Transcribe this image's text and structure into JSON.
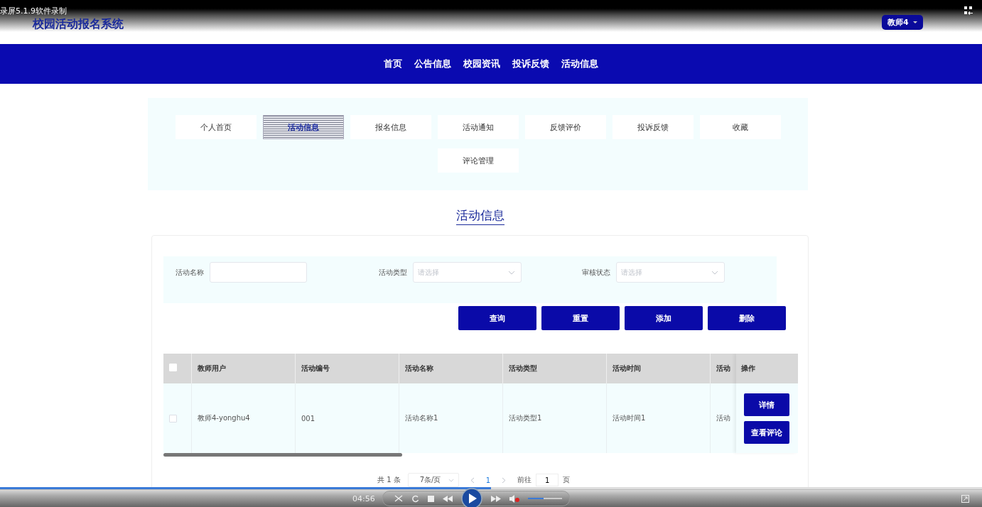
{
  "recorder": {
    "caption": "录屏5.1.9软件录制"
  },
  "header": {
    "title": "校园活动报名系统",
    "user_menu": "教师4"
  },
  "nav": [
    "首页",
    "公告信息",
    "校园资讯",
    "投诉反馈",
    "活动信息"
  ],
  "tabs": [
    {
      "label": "个人首页",
      "selected": false
    },
    {
      "label": "活动信息",
      "selected": true
    },
    {
      "label": "报名信息",
      "selected": false
    },
    {
      "label": "活动通知",
      "selected": false
    },
    {
      "label": "反馈评价",
      "selected": false
    },
    {
      "label": "投诉反馈",
      "selected": false
    },
    {
      "label": "收藏",
      "selected": false
    },
    {
      "label": "评论管理",
      "selected": false
    }
  ],
  "section_title": "活动信息",
  "filters": [
    {
      "label": "活动名称",
      "kind": "text"
    },
    {
      "label": "活动类型",
      "kind": "select",
      "placeholder": "请选择"
    },
    {
      "label": "审核状态",
      "kind": "select",
      "placeholder": "请选择"
    }
  ],
  "buttons": [
    "查询",
    "重置",
    "添加",
    "删除"
  ],
  "table": {
    "select_all_checked": false,
    "columns": [
      "教师用户",
      "活动编号",
      "活动名称",
      "活动类型",
      "活动时间",
      "活动"
    ],
    "action_column": "操作",
    "rows": [
      {
        "checked": false,
        "cells": [
          "教师4-yonghu4",
          "001",
          "活动名称1",
          "活动类型1",
          "活动时间1",
          "活动"
        ],
        "actions": [
          "详情",
          "查看评论"
        ]
      }
    ]
  },
  "pagination": {
    "total": "共 1 条",
    "page_size": "7条/页",
    "pages": [
      {
        "label": "1",
        "selected": true
      }
    ],
    "goto_label": "前往",
    "goto_value": "1",
    "goto_suffix": "页"
  },
  "player": {
    "time": "04:56",
    "progress": {
      "level": 0.5
    },
    "volume": {
      "level": 0.45
    }
  }
}
